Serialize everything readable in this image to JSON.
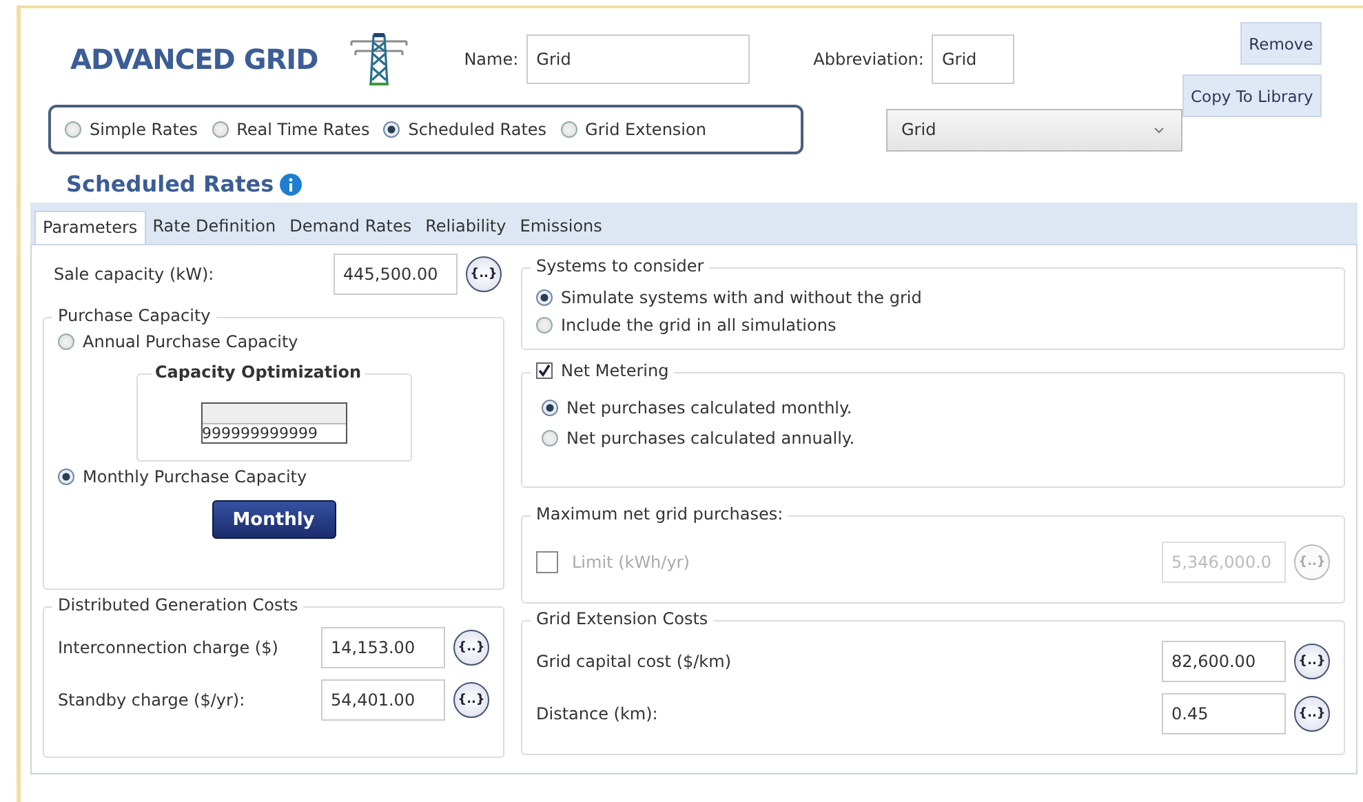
{
  "title": "ADVANCED GRID",
  "name_field": {
    "label": "Name:",
    "value": "Grid"
  },
  "abbreviation_field": {
    "label": "Abbreviation:",
    "value": "Grid"
  },
  "buttons": [
    "Remove",
    "Copy To Library"
  ],
  "rate_types": [
    {
      "label": "Simple Rates",
      "selected": false
    },
    {
      "label": "Real Time Rates",
      "selected": false
    },
    {
      "label": "Scheduled Rates",
      "selected": true
    },
    {
      "label": "Grid Extension",
      "selected": false
    }
  ],
  "library_dropdown": {
    "value": "Grid"
  },
  "section_title": "Scheduled Rates",
  "tabs": [
    {
      "label": "Parameters",
      "selected": true
    },
    {
      "label": "Rate Definition",
      "selected": false
    },
    {
      "label": "Demand Rates",
      "selected": false
    },
    {
      "label": "Reliability",
      "selected": false
    },
    {
      "label": "Emissions",
      "selected": false
    }
  ],
  "sale_capacity": {
    "label": "Sale capacity (kW):",
    "value": "445,500.00",
    "sensitivity": "{..}"
  },
  "purchase_capacity": {
    "title": "Purchase Capacity",
    "options": [
      {
        "label": "Annual Purchase Capacity",
        "selected": false
      },
      {
        "label": "Monthly Purchase Capacity",
        "selected": true
      }
    ],
    "capacity_optimization": {
      "title": "Capacity Optimization",
      "value": "999999999999"
    },
    "monthly_button": "Monthly"
  },
  "distributed_generation_costs": {
    "title": "Distributed Generation Costs",
    "fields": [
      {
        "label": "Interconnection charge ($)",
        "value": "14,153.00",
        "sensitivity": "{..}"
      },
      {
        "label": "Standby charge ($/yr):",
        "value": "54,401.00",
        "sensitivity": "{..}"
      }
    ]
  },
  "systems_to_consider": {
    "title": "Systems to consider",
    "options": [
      {
        "label": "Simulate systems with and without the grid",
        "selected": true
      },
      {
        "label": "Include the grid in all simulations",
        "selected": false
      }
    ]
  },
  "net_metering": {
    "label": "Net Metering",
    "checked": true,
    "options": [
      {
        "label": "Net purchases calculated monthly.",
        "selected": true
      },
      {
        "label": "Net purchases calculated annually.",
        "selected": false
      }
    ]
  },
  "maximum_net_grid_purchases": {
    "title": "Maximum net grid purchases:",
    "limit": {
      "label": "Limit (kWh/yr)",
      "checked": false,
      "disabled": true,
      "value": "5,346,000.0",
      "sensitivity": "{..}"
    }
  },
  "grid_extension_costs": {
    "title": "Grid Extension Costs",
    "fields": [
      {
        "label": "Grid capital cost ($/km)",
        "value": "82,600.00",
        "sensitivity": "{..}"
      },
      {
        "label": "Distance (km):",
        "value": "0.45",
        "sensitivity": "{..}"
      }
    ]
  }
}
